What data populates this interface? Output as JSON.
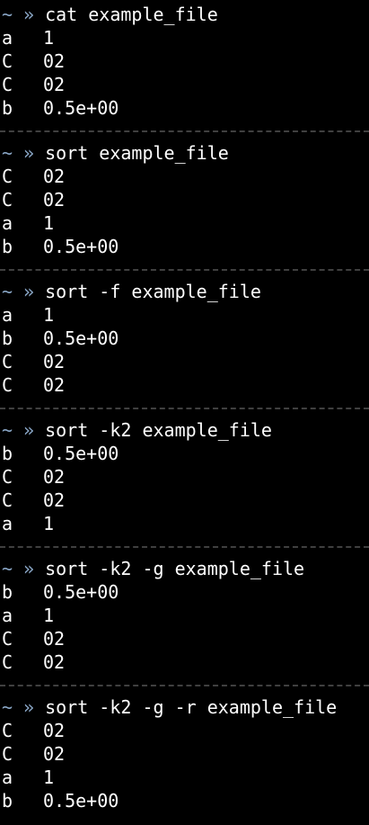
{
  "terminal": {
    "prompt_home": "~",
    "prompt_arrow": "»",
    "blocks": [
      {
        "command": "cat example_file",
        "rows": [
          {
            "key": "a",
            "value": "1"
          },
          {
            "key": "C",
            "value": "02"
          },
          {
            "key": "C",
            "value": "02"
          },
          {
            "key": "b",
            "value": "0.5e+00"
          }
        ]
      },
      {
        "command": "sort example_file",
        "rows": [
          {
            "key": "C",
            "value": "02"
          },
          {
            "key": "C",
            "value": "02"
          },
          {
            "key": "a",
            "value": "1"
          },
          {
            "key": "b",
            "value": "0.5e+00"
          }
        ]
      },
      {
        "command": "sort -f example_file",
        "rows": [
          {
            "key": "a",
            "value": "1"
          },
          {
            "key": "b",
            "value": "0.5e+00"
          },
          {
            "key": "C",
            "value": "02"
          },
          {
            "key": "C",
            "value": "02"
          }
        ]
      },
      {
        "command": "sort -k2 example_file",
        "rows": [
          {
            "key": "b",
            "value": "0.5e+00"
          },
          {
            "key": "C",
            "value": "02"
          },
          {
            "key": "C",
            "value": "02"
          },
          {
            "key": "a",
            "value": "1"
          }
        ]
      },
      {
        "command": "sort -k2 -g example_file",
        "rows": [
          {
            "key": "b",
            "value": "0.5e+00"
          },
          {
            "key": "a",
            "value": "1"
          },
          {
            "key": "C",
            "value": "02"
          },
          {
            "key": "C",
            "value": "02"
          }
        ]
      },
      {
        "command": "sort -k2 -g -r example_file",
        "rows": [
          {
            "key": "C",
            "value": "02"
          },
          {
            "key": "C",
            "value": "02"
          },
          {
            "key": "a",
            "value": "1"
          },
          {
            "key": "b",
            "value": "0.5e+00"
          }
        ]
      }
    ]
  },
  "colors": {
    "background": "#000000",
    "text": "#ffffff",
    "prompt": "#8aa7c7",
    "separator": "#404040"
  }
}
